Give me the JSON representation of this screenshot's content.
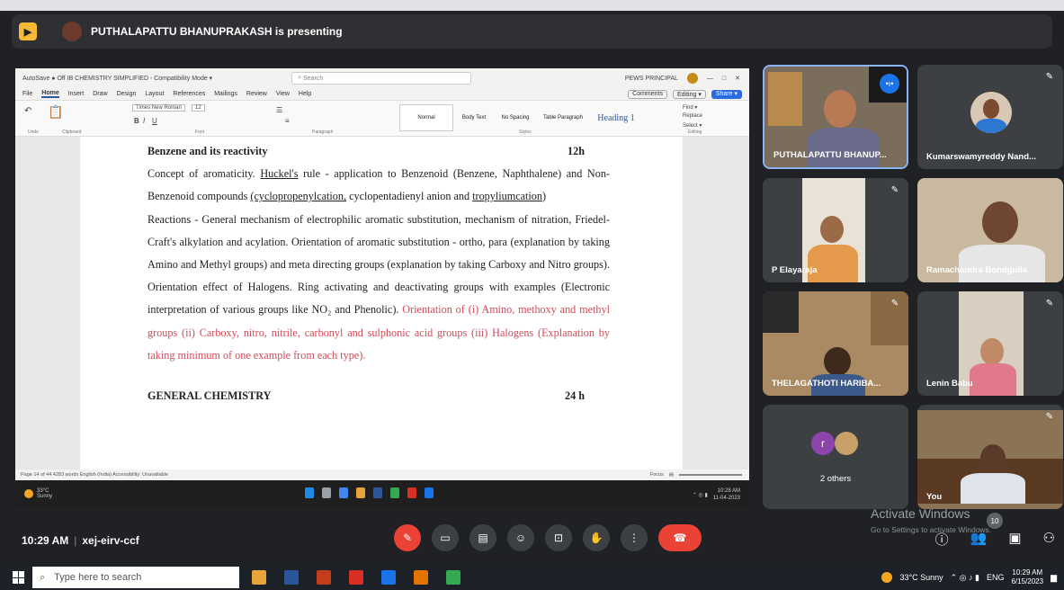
{
  "presenter": {
    "text": "PUTHALAPATTU BHANUPRAKASH is presenting",
    "logo": "present-icon"
  },
  "word": {
    "title": "AutoSave  ● Off   IB CHEMISTRY SIMPLIFIED - Compatibility Mode ▾",
    "search": "Search",
    "user": "PEWS PRINCIPAL",
    "menu": [
      "File",
      "Home",
      "Insert",
      "Draw",
      "Design",
      "Layout",
      "References",
      "Mailings",
      "Review",
      "View",
      "Help"
    ],
    "comments": "Comments",
    "editing": "Editing ▾",
    "share": "Share ▾",
    "font": "Times New Roman",
    "font_size": "12",
    "styles": [
      "Normal",
      "Body Text",
      "No Spacing",
      "Table Paragraph",
      "Heading 1"
    ],
    "find": "Find ▾",
    "replace": "Replace",
    "select": "Select ▾",
    "groups": [
      "Undo",
      "Clipboard",
      "Font",
      "Paragraph",
      "Styles",
      "Editing"
    ],
    "doc": {
      "h1": "Benzene and its reactivity",
      "h1_hours": "12h",
      "p1_a": "Concept of aromaticity. ",
      "p1_u1": "Huckel's",
      "p1_b": " rule - application to Benzenoid (Benzene, Naphthalene) and Non-Benzenoid compounds ",
      "p1_u2": "(cyclopropenylcation,",
      "p1_c": " cyclopentadienyl anion and ",
      "p1_u3": "tropyliumcation",
      "p1_d": ")",
      "p2": "Reactions - General mechanism of electrophilic aromatic substitution, mechanism of nitration, Friedel- Craft's alkylation and acylation. Orientation of aromatic substitution - ortho, para (explanation by taking Amino and Methyl groups) and meta directing groups (explanation by taking Carboxy and Nitro groups). Orientation effect of Halogens. Ring activating and deactivating groups with examples (Electronic interpretation of various groups like NO₂ and Phenolic). ",
      "p2_red": "Orientation of (i) Amino, methoxy and methyl groups (ii) Carboxy, nitro, nitrile, carbonyl and sulphonic acid groups (iii) Halogens (Explanation by taking minimum of one example from each type).",
      "h2": "GENERAL CHEMISTRY",
      "h2_hours": "24 h"
    },
    "status_left": "Page 14 of 44    4283 words    English (India)    Accessibility: Unavailable",
    "status_right": "Focus"
  },
  "inner_taskbar": {
    "weather": "33°C",
    "weather_sub": "Sunny",
    "time": "10:28 AM",
    "date": "11-04-2023"
  },
  "tiles": [
    {
      "name": "PUTHALAPATTU BHANUP..."
    },
    {
      "name": "Kumarswamyreddy Nand..."
    },
    {
      "name": "P Elayaraja"
    },
    {
      "name": "Ramachandra Bondgulla"
    },
    {
      "name": "THELAGATHOTI HARIBA..."
    },
    {
      "name": "Lenin Babu"
    },
    {
      "name": "2 others",
      "initial": "r"
    },
    {
      "name": "You"
    }
  ],
  "meeting": {
    "time": "10:29 AM",
    "code": "xej-eirv-ccf",
    "participants_badge": "10"
  },
  "activate": {
    "title": "Activate Windows",
    "sub": "Go to Settings to activate Windows."
  },
  "taskbar": {
    "search": "Type here to search",
    "weather": "33°C Sunny",
    "lang": "ENG",
    "time": "10:29 AM",
    "date": "6/15/2023"
  },
  "colors": {
    "meet_bg": "#202124",
    "end_call": "#ea4335",
    "word_blue": "#2b579a",
    "red_text": "#d14b57"
  }
}
